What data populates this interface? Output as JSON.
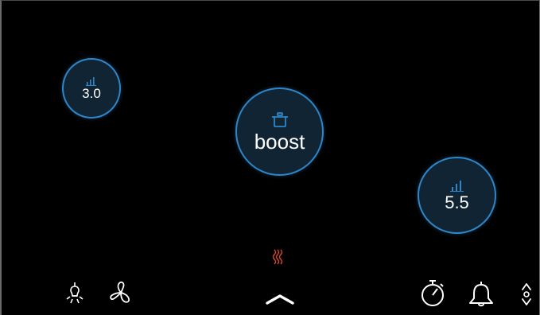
{
  "zones": {
    "left": {
      "value": "3.0",
      "icon": "power-level-icon"
    },
    "center": {
      "value": "boost",
      "icon": "pot-icon"
    },
    "right": {
      "value": "5.5",
      "icon": "power-level-icon"
    }
  },
  "bottom_bar": {
    "left_icons": [
      "light-bulb-icon",
      "fan-icon"
    ],
    "center_icons": [
      "heat-indicator-icon",
      "chevron-up-icon"
    ],
    "right_icons": [
      "timer-icon",
      "bell-icon",
      "up-down-arrows-icon"
    ]
  },
  "colors": {
    "background": "#000000",
    "zone_fill": "#102433",
    "zone_border": "#2e86c9",
    "accent_blue": "#2e86c9",
    "heat_red": "#e0462d",
    "icon_white": "#ffffff"
  }
}
